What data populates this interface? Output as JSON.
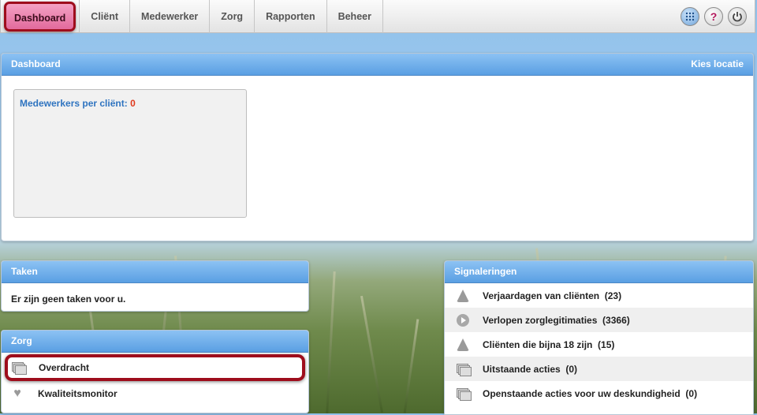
{
  "nav": {
    "items": [
      "Dashboard",
      "Cliënt",
      "Medewerker",
      "Zorg",
      "Rapporten",
      "Beheer"
    ],
    "active": "Dashboard"
  },
  "top_icons": [
    "apps-grid-icon",
    "help-icon",
    "power-icon"
  ],
  "dashboard": {
    "title": "Dashboard",
    "location_link": "Kies locatie",
    "stat_label": "Medewerkers per cliënt:",
    "stat_value": "0"
  },
  "taken": {
    "title": "Taken",
    "message": "Er zijn geen taken voor u."
  },
  "zorg": {
    "title": "Zorg",
    "items": [
      {
        "label": "Overdracht",
        "icon": "documents-icon",
        "highlighted": true
      },
      {
        "label": "Kwaliteitsmonitor",
        "icon": "heart-shield-icon",
        "highlighted": false
      }
    ]
  },
  "signaleringen": {
    "title": "Signaleringen",
    "items": [
      {
        "label": "Verjaardagen van cliënten",
        "count": "(23)",
        "icon": "bell-icon"
      },
      {
        "label": "Verlopen zorglegitimaties",
        "count": "(3366)",
        "icon": "play-icon"
      },
      {
        "label": "Cliënten die bijna 18 zijn",
        "count": "(15)",
        "icon": "bell-icon"
      },
      {
        "label": "Uitstaande acties",
        "count": "(0)",
        "icon": "documents-icon"
      },
      {
        "label": "Openstaande acties voor uw deskundigheid",
        "count": "(0)",
        "icon": "documents-icon"
      }
    ]
  },
  "colors": {
    "accent_blue": "#5a9fe3",
    "highlight_red": "#9e0d1c",
    "active_tab_pink": "#e26a9c",
    "stat_value_red": "#e0391c"
  }
}
